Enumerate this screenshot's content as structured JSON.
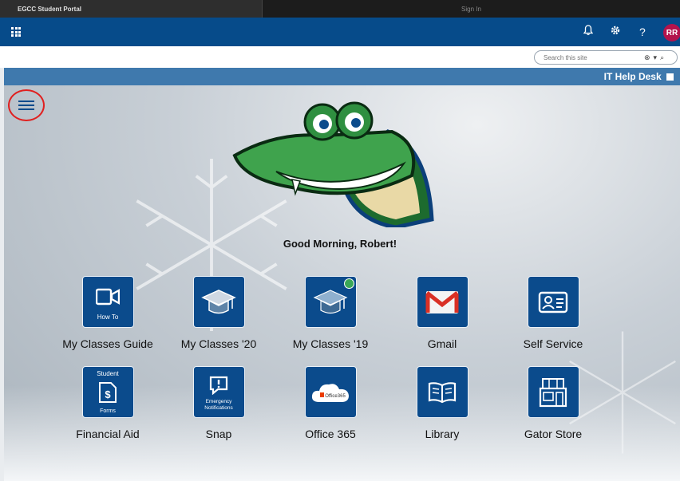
{
  "browser": {
    "active_tab_title": "EGCC Student Portal",
    "other_tab_title": "Sign In"
  },
  "topbar": {
    "avatar_initials": "RR",
    "help_symbol": "?"
  },
  "search": {
    "placeholder": "Search this site"
  },
  "helpbar": {
    "label": "IT Help Desk"
  },
  "greeting": "Good Morning, Robert!",
  "tiles": [
    {
      "label": "My Classes Guide",
      "caption": "How To"
    },
    {
      "label": "My Classes '20"
    },
    {
      "label": "My Classes '19"
    },
    {
      "label": "Gmail"
    },
    {
      "label": "Self Service"
    },
    {
      "label": "Financial Aid",
      "caption_top": "Student",
      "caption": "Forms"
    },
    {
      "label": "Snap",
      "caption": "Emergency Notifications"
    },
    {
      "label": "Office 365",
      "caption": "Office365"
    },
    {
      "label": "Library"
    },
    {
      "label": "Gator Store"
    }
  ],
  "colors": {
    "topbar": "#064b8a",
    "tile": "#0b4b8c",
    "helpbar": "#3f79ad",
    "avatar": "#b3134c",
    "highlight_circle": "#e0201f"
  }
}
